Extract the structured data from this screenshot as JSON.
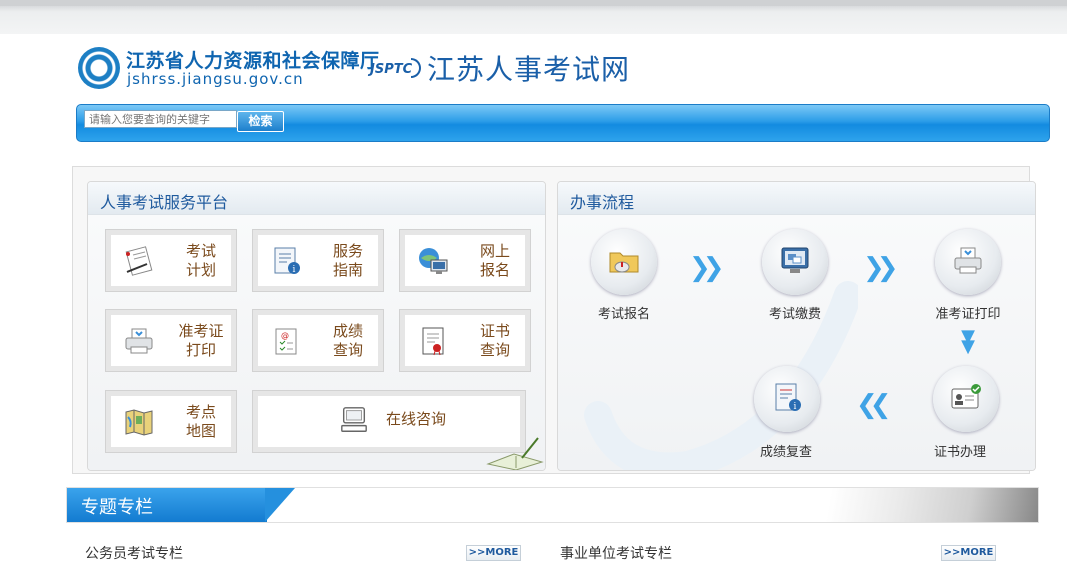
{
  "header": {
    "org_name": "江苏省人力资源和社会保障厅",
    "org_url": "jshrss.jiangsu.gov.cn",
    "jsptc": "JSPTC",
    "site_title": "江苏人事考试网"
  },
  "search": {
    "placeholder": "请输入您要查询的关键字",
    "button_label": "检索"
  },
  "service_panel": {
    "title": "人事考试服务平台",
    "items": [
      {
        "label": "考试\n计划",
        "icon": "document-pen-icon"
      },
      {
        "label": "服务\n指南",
        "icon": "guide-info-icon"
      },
      {
        "label": "网上\n报名",
        "icon": "globe-computer-icon"
      },
      {
        "label": "准考证\n打印",
        "icon": "printer-icon"
      },
      {
        "label": "成绩\n查询",
        "icon": "score-checklist-icon"
      },
      {
        "label": "证书\n查询",
        "icon": "certificate-icon"
      },
      {
        "label": "考点\n地图",
        "icon": "map-icon"
      },
      {
        "label": "在线咨询",
        "icon": "computer-icon"
      }
    ]
  },
  "process_panel": {
    "title": "办事流程",
    "steps": [
      {
        "label": "考试报名",
        "icon": "folder-mouse-icon"
      },
      {
        "label": "考试缴费",
        "icon": "payment-screen-icon"
      },
      {
        "label": "准考证打印",
        "icon": "printer-icon"
      },
      {
        "label": "成绩复查",
        "icon": "document-info-icon"
      },
      {
        "label": "证书办理",
        "icon": "id-card-check-icon"
      }
    ]
  },
  "topics": {
    "title": "专题专栏",
    "columns": [
      {
        "title": "公务员考试专栏",
        "more": "MORE"
      },
      {
        "title": "事业单位考试专栏",
        "more": "MORE"
      }
    ]
  },
  "colors": {
    "brand_blue": "#1a5fa8",
    "search_blue": "#1f95e3",
    "label_brown": "#7a4a1c",
    "arrow_blue": "#3fa3e6"
  }
}
